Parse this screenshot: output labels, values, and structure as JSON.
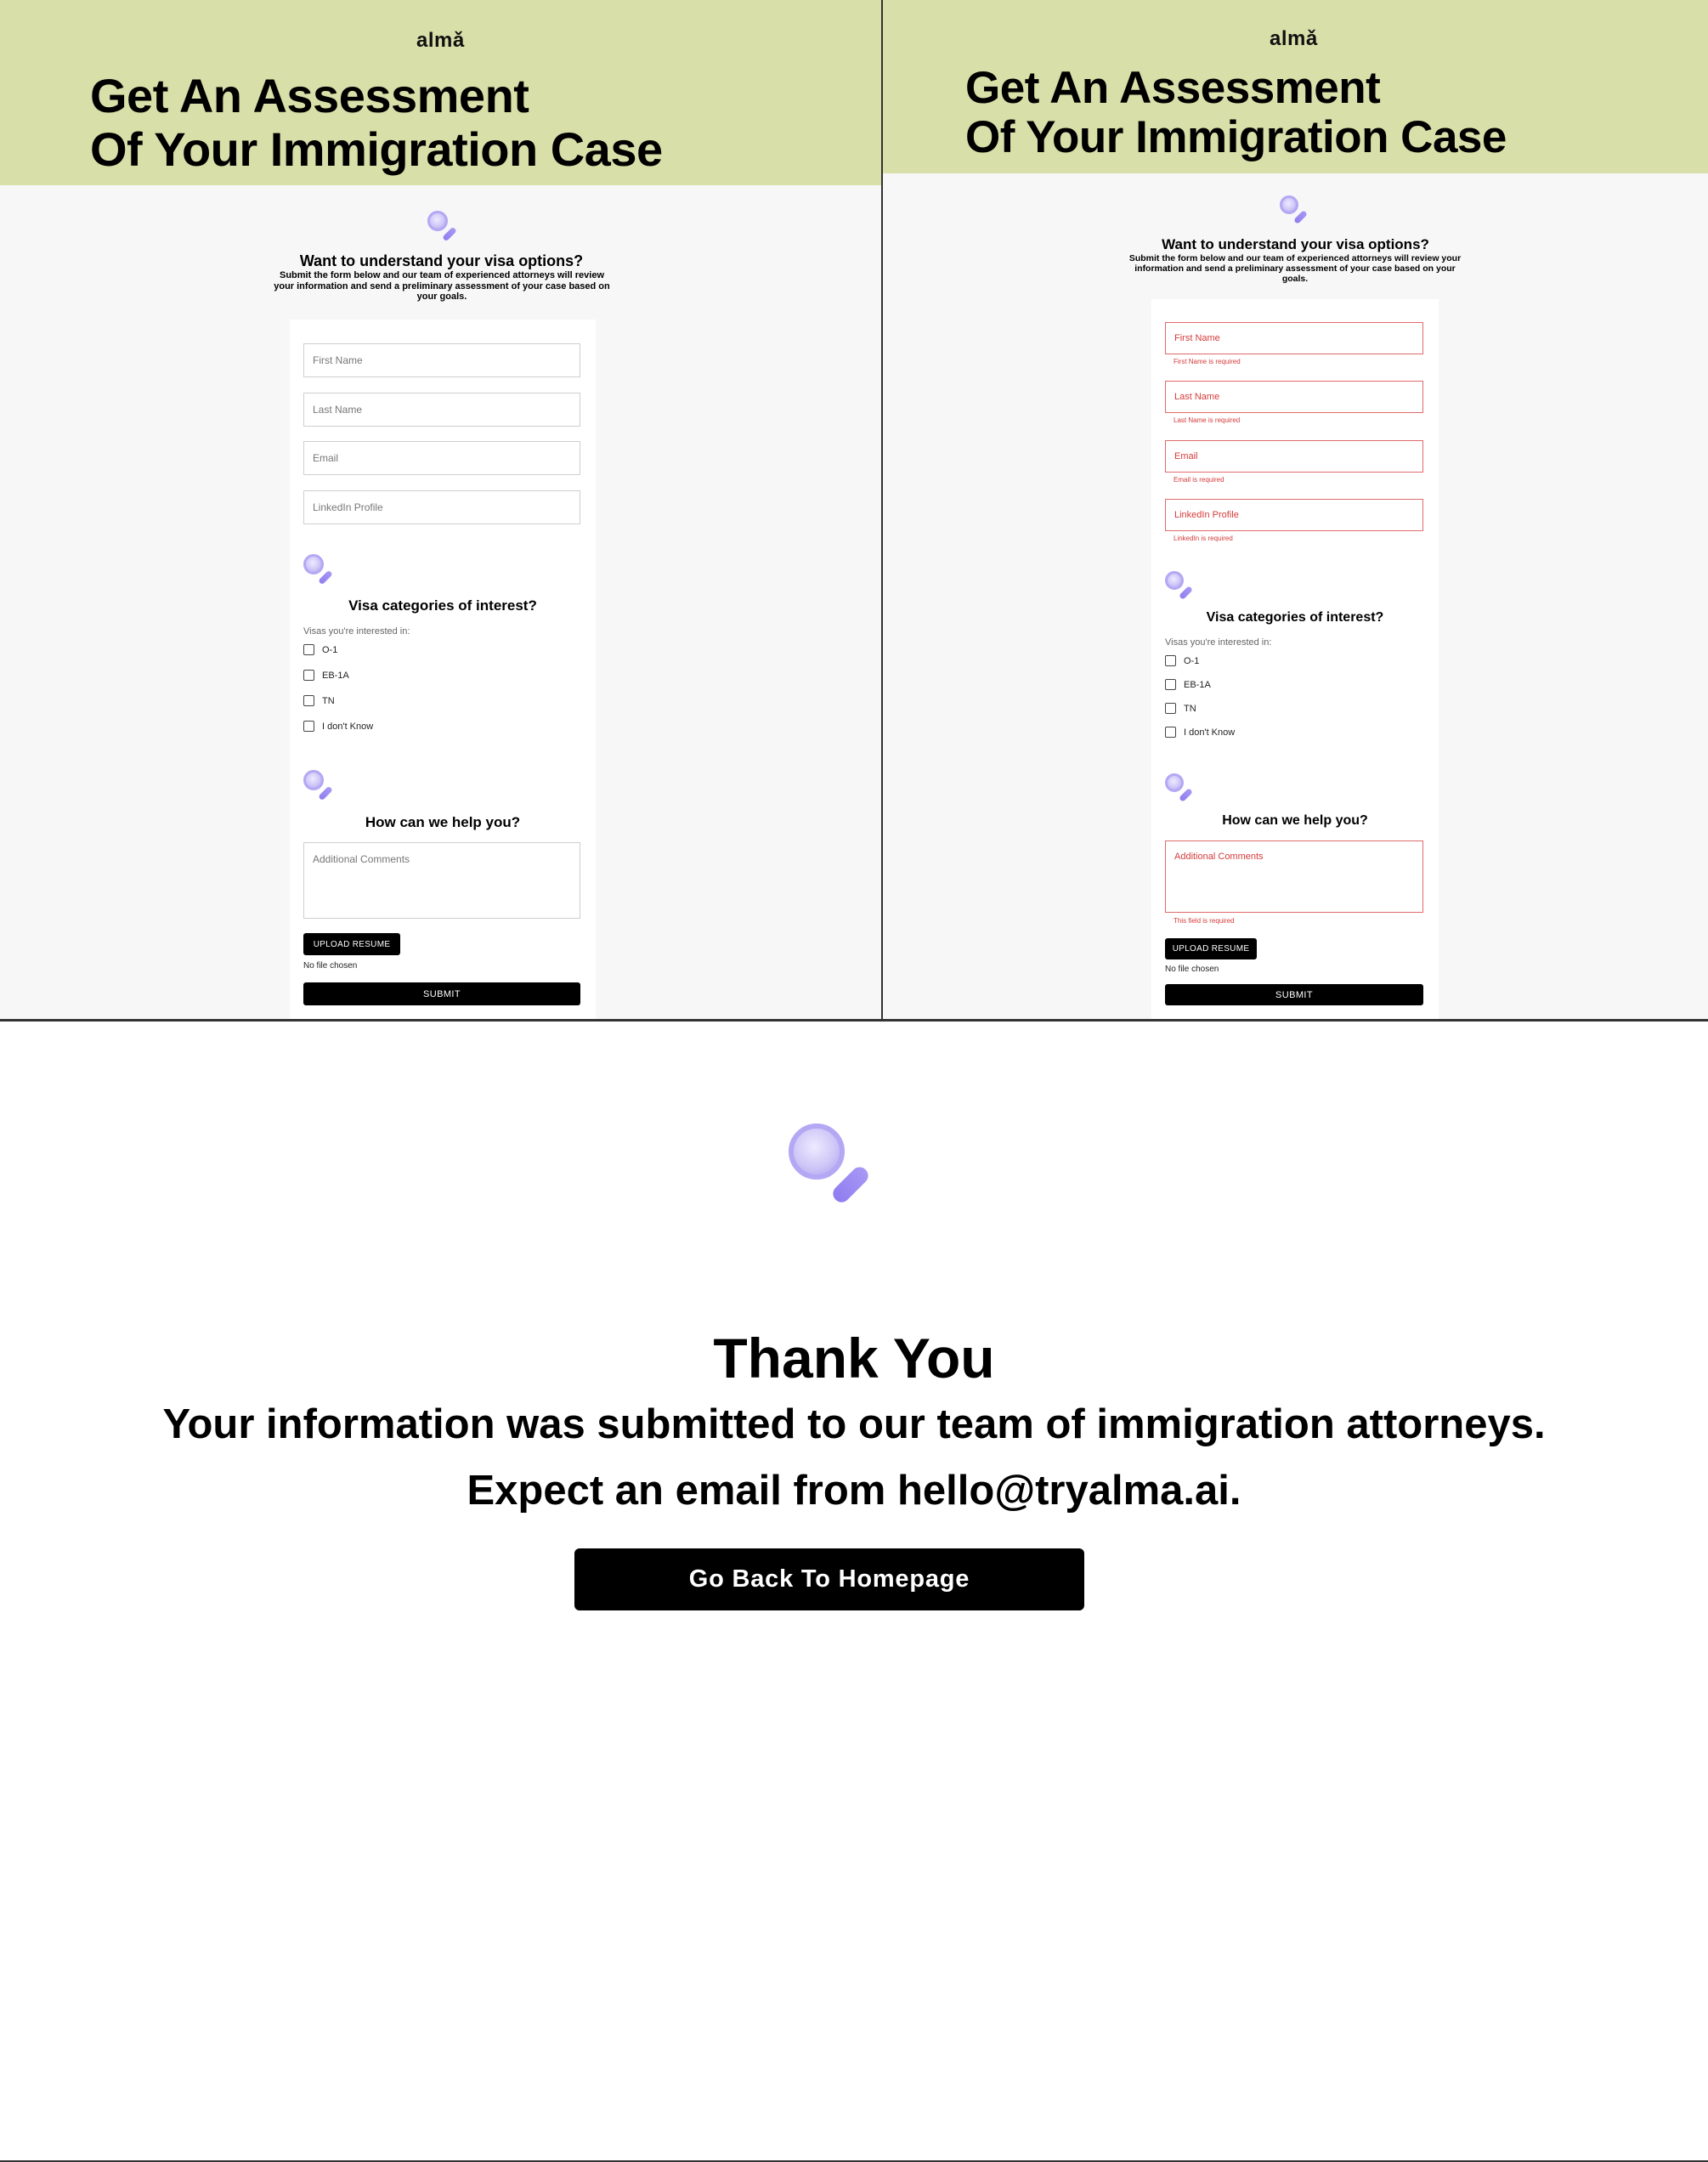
{
  "brand": {
    "logo": "almǎ"
  },
  "hero": {
    "title_line1": "Get An Assessment",
    "title_line2": "Of Your Immigration Case"
  },
  "intro": {
    "title": "Want to understand your visa options?",
    "subtitle": "Submit the form below and our team of experienced attorneys will review your information and send a preliminary assessment of your case based on your goals."
  },
  "form": {
    "fields": {
      "first_name": {
        "placeholder": "First Name",
        "error": "First Name is required"
      },
      "last_name": {
        "placeholder": "Last Name",
        "error": "Last Name is required"
      },
      "email": {
        "placeholder": "Email",
        "error": "Email is required"
      },
      "linkedin": {
        "placeholder": "LinkedIn Profile",
        "error": "LinkedIn is required"
      }
    },
    "visa_section": {
      "title": "Visa categories of interest?",
      "label": "Visas you're interested in:",
      "options": [
        "O-1",
        "EB-1A",
        "TN",
        "I don't Know"
      ]
    },
    "help_section": {
      "title": "How can we help you?",
      "comments_placeholder": "Additional Comments",
      "comments_error": "This field is required"
    },
    "upload_label": "UPLOAD RESUME",
    "no_file": "No file chosen",
    "submit_label": "SUBMIT"
  },
  "thank_you": {
    "title": "Thank You",
    "line1": "Your information was submitted to our team of immigration attorneys.",
    "line2": "Expect an email from hello@tryalma.ai.",
    "button_label": "Go Back To Homepage"
  },
  "colors": {
    "hero_bg": "#d9dfa8",
    "error": "#d63b3b",
    "accent_icon": "#a99bf0"
  },
  "icons": [
    "magnifier-icon",
    "checkbox-icon"
  ]
}
